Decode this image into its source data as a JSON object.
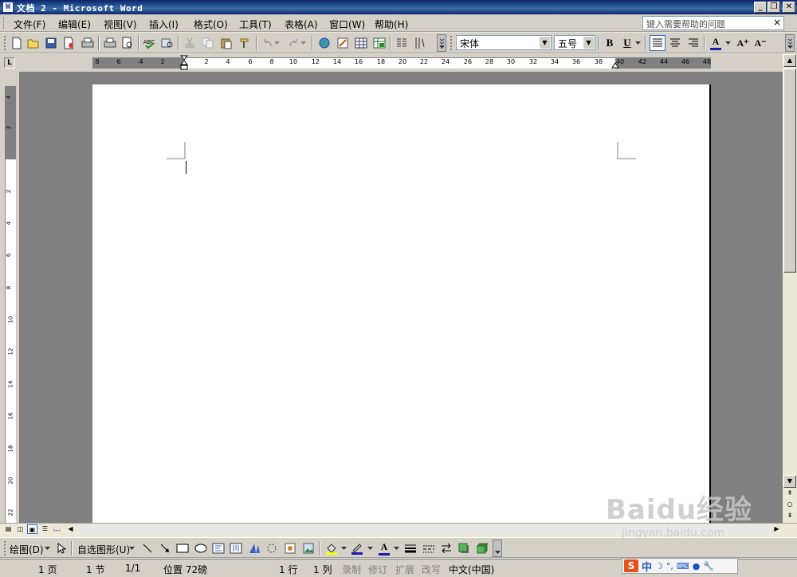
{
  "window": {
    "title": "文档 2 - Microsoft Word",
    "icon": "word-doc-icon",
    "controls": [
      "_",
      "❐",
      "✕"
    ]
  },
  "menubar": {
    "items": [
      "文件(F)",
      "编辑(E)",
      "视图(V)",
      "插入(I)",
      "格式(O)",
      "工具(T)",
      "表格(A)",
      "窗口(W)",
      "帮助(H)"
    ],
    "help_placeholder": "键入需要帮助的问题"
  },
  "toolbar": {
    "font_name": "宋体",
    "font_size": "五号",
    "bold": "B",
    "underline": "U",
    "font_color_glyph": "A",
    "grow_font": "A⁺",
    "shrink_font": "A⁻"
  },
  "ruler": {
    "tab_selector": "L",
    "left_numbers": [
      "8",
      "6",
      "4",
      "2"
    ],
    "right_numbers": [
      "2",
      "4",
      "6",
      "8",
      "10",
      "12",
      "14",
      "16",
      "18",
      "20",
      "22",
      "24",
      "26",
      "28",
      "30",
      "32",
      "34",
      "36",
      "38",
      "40",
      "42",
      "44",
      "46",
      "48"
    ],
    "vertical_top_numbers": [
      "4",
      "2"
    ],
    "vertical_numbers": [
      "2",
      "4",
      "6",
      "8",
      "10",
      "12",
      "14",
      "16",
      "18",
      "20",
      "22"
    ]
  },
  "drawbar": {
    "draw_label": "绘图(D)",
    "autoshape_label": "自选图形(U)"
  },
  "statusbar": {
    "page": "1 页",
    "section": "1 节",
    "page_of": "1/1",
    "position": "位置 72磅",
    "line": "1 行",
    "column": "1 列",
    "rec": "录制",
    "trk": "修订",
    "ext": "扩展",
    "ovr": "改写",
    "language": "中文(中国)"
  },
  "ime": {
    "logo": "S",
    "mode": "中"
  },
  "watermark": {
    "brand": "Baidu经验",
    "url": "jingyan.baidu.com"
  },
  "colors": {
    "titlebar": "#0a246a",
    "chrome": "#d4d0c8",
    "workspace": "#808080",
    "page": "#ffffff"
  }
}
